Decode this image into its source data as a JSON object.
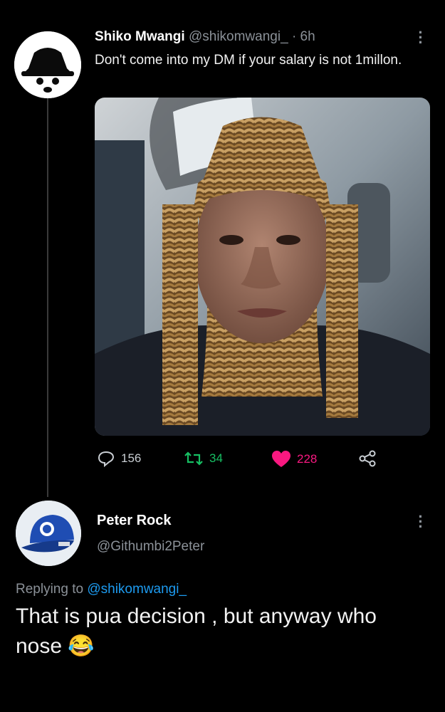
{
  "tweet": {
    "author_name": "Shiko Mwangi",
    "author_handle": "@shikomwangi_",
    "time": "· 6h",
    "text": "Don't come into my DM if your salary is not 1millon.",
    "stats": {
      "replies": "156",
      "retweets": "34",
      "likes": "228"
    }
  },
  "reply": {
    "author_name": "Peter Rock",
    "author_handle": "@Githumbi2Peter",
    "replying_prefix": "Replying to",
    "replying_to": "@shikomwangi_",
    "text": "That is pua decision , but anyway who nose",
    "emoji": "😂"
  },
  "colors": {
    "retweet": "#17bf63",
    "like": "#f91880",
    "link": "#1d9bf0",
    "muted": "#8b9198"
  },
  "icons": [
    "reply-icon",
    "retweet-icon",
    "heart-icon",
    "share-icon",
    "more-icon"
  ]
}
